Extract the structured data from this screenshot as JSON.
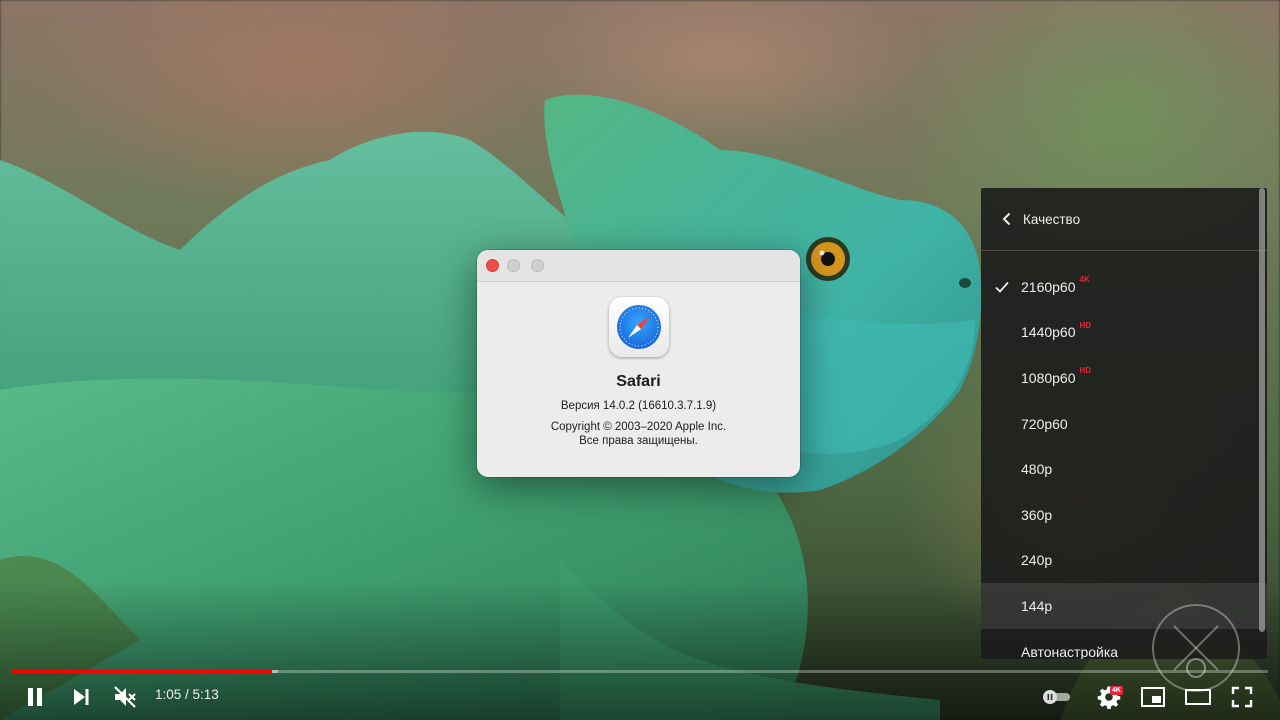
{
  "about_dialog": {
    "app_name": "Safari",
    "version": "Версия 14.0.2 (16610.3.7.1.9)",
    "copyright_line1": "Copyright © 2003–2020 Apple Inc.",
    "copyright_line2": "Все права защищены.",
    "icon": "safari-compass-icon"
  },
  "quality_menu": {
    "title": "Качество",
    "options": [
      {
        "label": "2160p60",
        "badge": "4K",
        "selected": true
      },
      {
        "label": "1440p60",
        "badge": "HD",
        "selected": false
      },
      {
        "label": "1080p60",
        "badge": "HD",
        "selected": false
      },
      {
        "label": "720p60",
        "badge": "",
        "selected": false
      },
      {
        "label": "480p",
        "badge": "",
        "selected": false
      },
      {
        "label": "360p",
        "badge": "",
        "selected": false
      },
      {
        "label": "240p",
        "badge": "",
        "selected": false
      },
      {
        "label": "144p",
        "badge": "",
        "selected": false
      },
      {
        "label": "Автонастройка",
        "badge": "",
        "selected": false
      }
    ]
  },
  "player": {
    "time_display": "1:05 / 5:13",
    "progress_played_fraction": 0.207,
    "progress_loaded_fraction": 0.212,
    "settings_badge": "4K",
    "accent_color": "#ff0000",
    "badge_color": "#e2263b"
  }
}
